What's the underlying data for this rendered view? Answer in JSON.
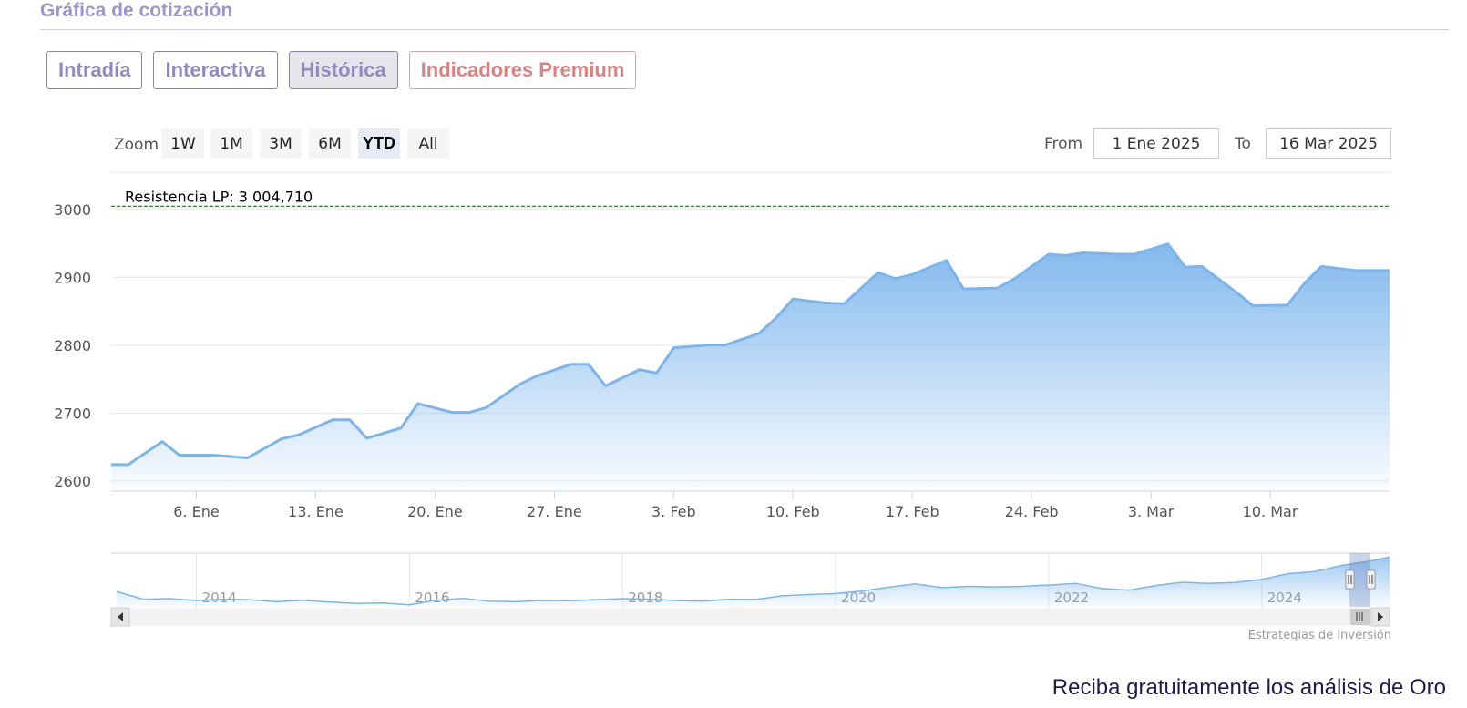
{
  "section": {
    "title": "Gráfica de cotización"
  },
  "tabs": [
    {
      "label": "Intradía",
      "active": false
    },
    {
      "label": "Interactiva",
      "active": false
    },
    {
      "label": "Histórica",
      "active": true
    },
    {
      "label": "Indicadores Premium",
      "active": false
    }
  ],
  "zoom": {
    "label": "Zoom",
    "buttons": [
      "1W",
      "1M",
      "3M",
      "6M",
      "YTD",
      "All"
    ],
    "selected": "YTD"
  },
  "range": {
    "from_label": "From",
    "from_value": "1 Ene 2025",
    "to_label": "To",
    "to_value": "16 Mar 2025"
  },
  "credit": "Estrategias de Inversión",
  "footer": {
    "link_text": "Reciba gratuitamente los análisis de Oro"
  },
  "colors": {
    "accent": "#7cb5ec",
    "tab_text": "#9089c2",
    "premium": "#d98383",
    "resistance": "#1a7a1a"
  },
  "chart_data": {
    "type": "area",
    "x_start": "2025-01-01",
    "x": [
      0,
      1,
      3,
      4,
      6,
      7,
      8,
      10,
      11,
      13,
      14,
      15,
      17,
      18,
      20,
      21,
      22,
      24,
      25,
      27,
      28,
      29,
      31,
      32,
      33,
      35,
      36,
      38,
      39,
      40,
      42,
      43,
      45,
      46,
      47,
      49,
      50,
      52,
      53,
      55,
      56,
      57,
      59,
      60,
      62,
      63,
      64,
      66,
      67,
      69,
      70,
      71,
      73,
      74,
      75
    ],
    "values": [
      2624,
      2624,
      2658,
      2638,
      2638,
      2636,
      2634,
      2662,
      2668,
      2690,
      2690,
      2663,
      2678,
      2714,
      2701,
      2701,
      2708,
      2743,
      2755,
      2772,
      2772,
      2740,
      2764,
      2759,
      2796,
      2800,
      2800,
      2817,
      2840,
      2868,
      2862,
      2861,
      2907,
      2898,
      2904,
      2925,
      2883,
      2884,
      2898,
      2934,
      2932,
      2936,
      2934,
      2934,
      2949,
      2915,
      2916,
      2878,
      2858,
      2859,
      2891,
      2916,
      2910,
      2910,
      2910
    ],
    "ylim": [
      2585,
      3040
    ],
    "yticks": [
      2600,
      2700,
      2800,
      2900,
      3000
    ],
    "xticks": [
      {
        "day": 5,
        "label": "6. Ene"
      },
      {
        "day": 12,
        "label": "13. Ene"
      },
      {
        "day": 19,
        "label": "20. Ene"
      },
      {
        "day": 26,
        "label": "27. Ene"
      },
      {
        "day": 33,
        "label": "3. Feb"
      },
      {
        "day": 40,
        "label": "10. Feb"
      },
      {
        "day": 47,
        "label": "17. Feb"
      },
      {
        "day": 54,
        "label": "24. Feb"
      },
      {
        "day": 61,
        "label": "3. Mar"
      },
      {
        "day": 68,
        "label": "10. Mar"
      }
    ],
    "resistance": {
      "label": "Resistencia LP: 3 004,710",
      "value": 3004.71
    },
    "navigator": {
      "year_labels": [
        "2014",
        "2016",
        "2018",
        "2020",
        "2022",
        "2024"
      ],
      "year_positions": [
        2014,
        2016,
        2018,
        2020,
        2022,
        2024
      ],
      "year_range": [
        2013.2,
        2025.2
      ],
      "years": [
        2013.25,
        2013.5,
        2013.75,
        2014,
        2014.25,
        2014.5,
        2014.75,
        2015,
        2015.25,
        2015.5,
        2015.75,
        2016,
        2016.25,
        2016.5,
        2016.75,
        2017,
        2017.25,
        2017.5,
        2017.75,
        2018,
        2018.25,
        2018.5,
        2018.75,
        2019,
        2019.25,
        2019.5,
        2019.75,
        2020,
        2020.25,
        2020.5,
        2020.75,
        2021,
        2021.25,
        2021.5,
        2021.75,
        2022,
        2022.25,
        2022.5,
        2022.75,
        2023,
        2023.25,
        2023.5,
        2023.75,
        2024,
        2024.25,
        2024.5,
        2024.75,
        2025.0,
        2025.2
      ],
      "values": [
        1600,
        1300,
        1320,
        1250,
        1300,
        1280,
        1200,
        1260,
        1190,
        1130,
        1150,
        1080,
        1260,
        1330,
        1220,
        1200,
        1250,
        1240,
        1280,
        1320,
        1300,
        1250,
        1220,
        1300,
        1290,
        1430,
        1480,
        1520,
        1620,
        1770,
        1900,
        1750,
        1800,
        1780,
        1800,
        1850,
        1920,
        1720,
        1650,
        1830,
        1960,
        1920,
        1950,
        2070,
        2300,
        2380,
        2620,
        2780,
        2950
      ],
      "ylim": [
        1000,
        3100
      ]
    }
  }
}
